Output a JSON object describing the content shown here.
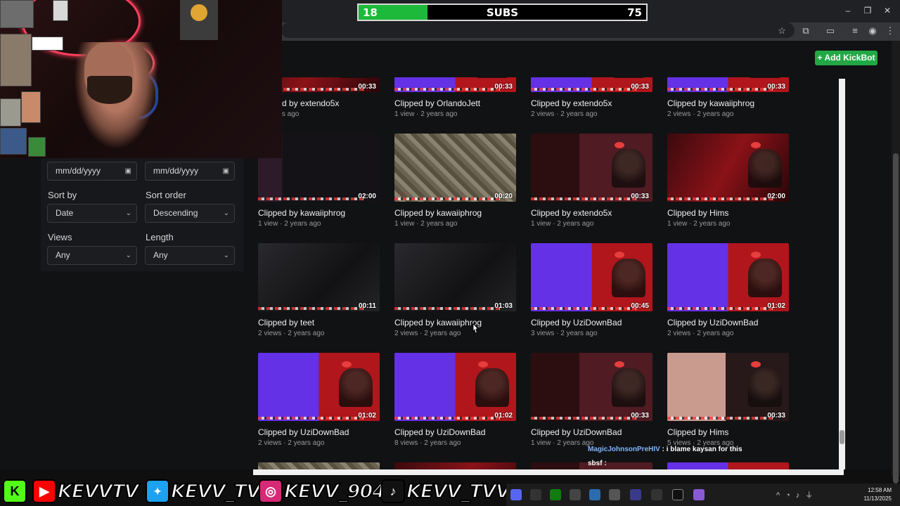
{
  "subgoal": {
    "current": "18",
    "label": "SUBS",
    "goal": "75",
    "progress": 0.24
  },
  "page": {
    "add_button": "+ Add KickBot"
  },
  "filters": {
    "date_from_placeholder": "mm/dd/yyyy",
    "date_to_placeholder": "mm/dd/yyyy",
    "sort_by_label": "Sort by",
    "sort_by_value": "Date",
    "sort_order_label": "Sort order",
    "sort_order_value": "Descending",
    "views_label": "Views",
    "views_value": "Any",
    "length_label": "Length",
    "length_value": "Any"
  },
  "clips": [
    {
      "title": "Clipped by extendo5x",
      "meta": "· 2 years ago",
      "duration": "00:33",
      "style": "t-red"
    },
    {
      "title": "Clipped by OrlandoJett",
      "meta": "1 view · 2 years ago",
      "duration": "00:33",
      "style": "t-purple"
    },
    {
      "title": "Clipped by extendo5x",
      "meta": "2 views · 2 years ago",
      "duration": "00:33",
      "style": "t-purple"
    },
    {
      "title": "Clipped by kawaiiphrog",
      "meta": "2 views · 2 years ago",
      "duration": "00:33",
      "style": "t-purple"
    },
    {
      "title": "Clipped by kawaiiphrog",
      "meta": "1 view · 2 years ago",
      "duration": "02:00",
      "style": "t-desk"
    },
    {
      "title": "Clipped by kawaiiphrog",
      "meta": "1 view · 2 years ago",
      "duration": "00:20",
      "style": "t-cave"
    },
    {
      "title": "Clipped by extendo5x",
      "meta": "1 view · 2 years ago",
      "duration": "00:33",
      "style": "t-mixed"
    },
    {
      "title": "Clipped by Hims",
      "meta": "1 view · 2 years ago",
      "duration": "02:00",
      "style": "t-red"
    },
    {
      "title": "Clipped by teet",
      "meta": "2 views · 2 years ago",
      "duration": "00:11",
      "style": "t-dark"
    },
    {
      "title": "Clipped by kawaiiphrog",
      "meta": "2 views · 2 years ago",
      "duration": "01:03",
      "style": "t-dark"
    },
    {
      "title": "Clipped by UziDownBad",
      "meta": "3 views · 2 years ago",
      "duration": "00:45",
      "style": "t-purple"
    },
    {
      "title": "Clipped by UziDownBad",
      "meta": "2 views · 2 years ago",
      "duration": "01:02",
      "style": "t-purple"
    },
    {
      "title": "Clipped by UziDownBad",
      "meta": "2 views · 2 years ago",
      "duration": "01:02",
      "style": "t-purple"
    },
    {
      "title": "Clipped by UziDownBad",
      "meta": "8 views · 2 years ago",
      "duration": "01:02",
      "style": "t-purple"
    },
    {
      "title": "Clipped by UziDownBad",
      "meta": "1 view · 2 years ago",
      "duration": "00:33",
      "style": "t-mixed"
    },
    {
      "title": "Clipped by Hims",
      "meta": "5 views · 2 years ago",
      "duration": "00:33",
      "style": "t-pink"
    }
  ],
  "chat": {
    "user": "MagicJohnsonPreHIV",
    "message": " : i blame kaysan for this",
    "user2": "sbsf :"
  },
  "socials": [
    {
      "icon": "kick-icon",
      "glyph": "K",
      "color": "#53fc18",
      "handle": ""
    },
    {
      "icon": "youtube-icon",
      "glyph": "▶",
      "color": "#ff0000",
      "handle": "KEVVTV"
    },
    {
      "icon": "twitter-icon",
      "glyph": "🐦",
      "color": "#1da1f2",
      "handle": "KEVV_TV"
    },
    {
      "icon": "instagram-icon",
      "glyph": "◎",
      "color": "#d62976",
      "handle": "KEVV_904"
    },
    {
      "icon": "tiktok-icon",
      "glyph": "♪",
      "color": "#111111",
      "handle": "KEVV_TVV"
    }
  ],
  "clock": {
    "time": "12:58 AM",
    "date": "11/13/2025"
  }
}
